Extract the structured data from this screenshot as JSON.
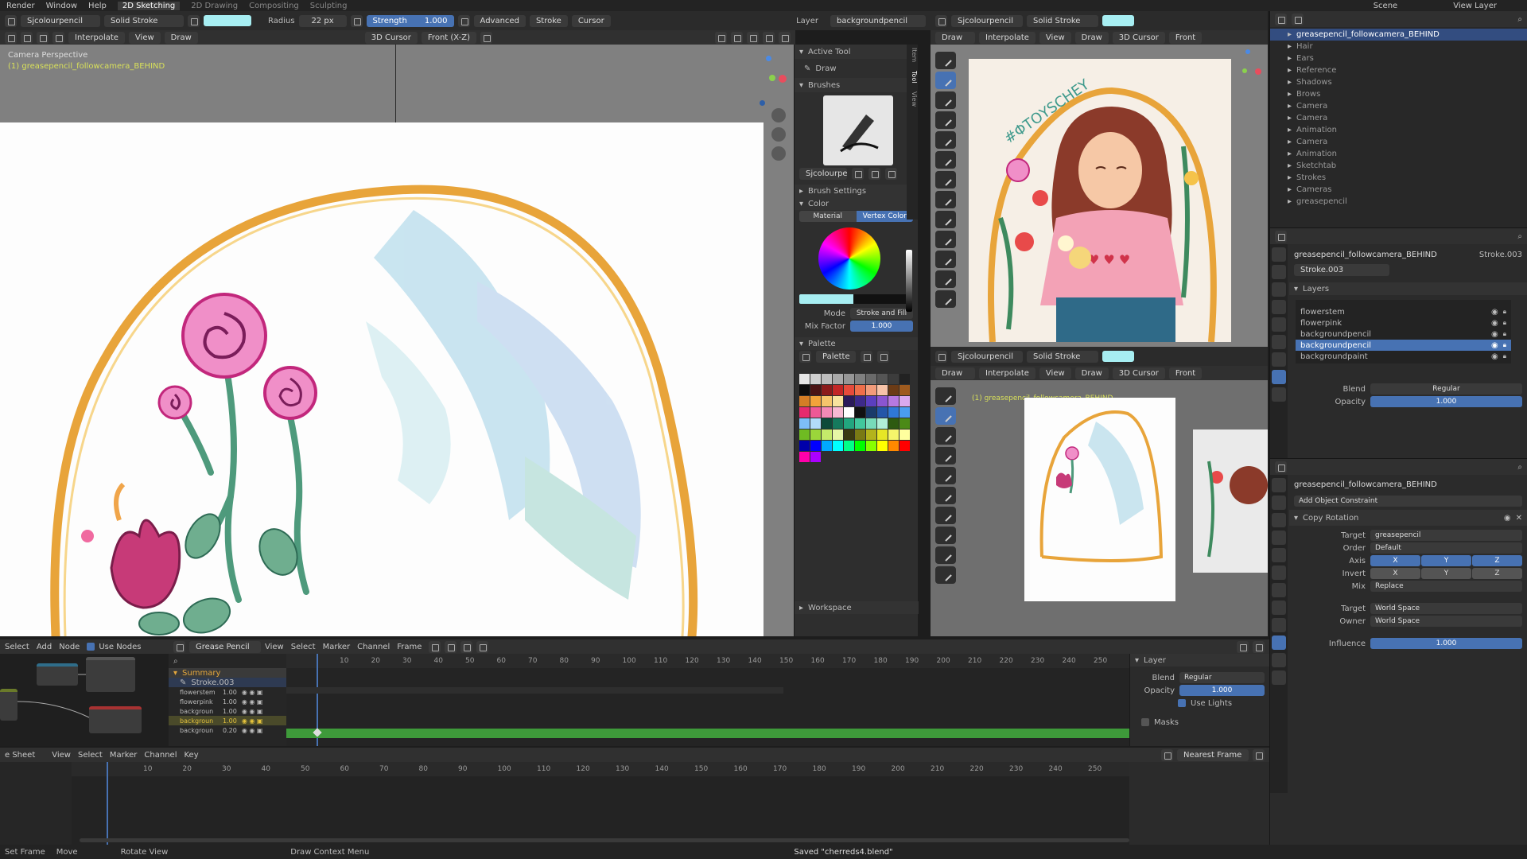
{
  "topbar": {
    "menus": [
      "Render",
      "Window",
      "Help"
    ],
    "workspaces": [
      "2D Sketching",
      "2D Drawing",
      "Compositing",
      "Sculpting"
    ],
    "scene": "Scene",
    "view_layer": "View Layer"
  },
  "toolheader": {
    "object": "Sjcolourpencil",
    "stroke_mode": "Solid Stroke",
    "radius_label": "Radius",
    "radius_value": "22 px",
    "strength_label": "Strength",
    "strength_value": "1.000",
    "advanced": "Advanced",
    "stroke": "Stroke",
    "cursor": "Cursor",
    "layer_label": "Layer",
    "layer_value": "backgroundpencil"
  },
  "mainview": {
    "interpolate": "Interpolate",
    "view": "View",
    "draw": "Draw",
    "cursor3d": "3D Cursor",
    "front": "Front (X-Z)",
    "info": "Camera Perspective",
    "subinfo": "(1) greasepencil_followcamera_BEHIND"
  },
  "sidebar": {
    "tabs": [
      "Item",
      "Tool",
      "View"
    ],
    "active_tool_header": "Active Tool",
    "active_tool": "Draw",
    "brushes_header": "Brushes",
    "brush_name": "Sjcolourpe...",
    "brush_settings": "Brush Settings",
    "color_header": "Color",
    "color_tabs": [
      "Material",
      "Vertex Color"
    ],
    "mode_label": "Mode",
    "mode_value": "Stroke and Fill",
    "mix_label": "Mix Factor",
    "mix_value": "1.000",
    "palette_header": "Palette",
    "palette_name": "Palette",
    "workspace": "Workspace"
  },
  "palette": {
    "colors": [
      "#e6e6e6",
      "#cfcfcf",
      "#bdbdbd",
      "#a9a9a9",
      "#969696",
      "#808080",
      "#6a6a6a",
      "#555555",
      "#3c3c3c",
      "#222222",
      "#0d0d0d",
      "#4b1414",
      "#8b1b1b",
      "#c22626",
      "#e64a3b",
      "#ef6e4a",
      "#f29b7a",
      "#f7c3a8",
      "#6b3b16",
      "#9e5a1e",
      "#d47d25",
      "#f2a33a",
      "#f5c56b",
      "#f7e39e",
      "#2b1a5a",
      "#3d2a8a",
      "#5b3fbf",
      "#8a55d1",
      "#b679e0",
      "#d9a9ee",
      "#e62a6e",
      "#ef5896",
      "#f48ab6",
      "#f7b9d3",
      "#ffffff",
      "#111111",
      "#1a3a6a",
      "#2456a8",
      "#2f78d6",
      "#4a9df0",
      "#7dbef7",
      "#b3dcfa",
      "#0d4a3a",
      "#157a5d",
      "#22a67f",
      "#41c79c",
      "#77dbb9",
      "#b0eed6",
      "#2e5a10",
      "#4b8a17",
      "#6fbb22",
      "#9bd63a",
      "#c4ea6a",
      "#e6f7a6",
      "#3a3a10",
      "#7a7a14",
      "#b3b31c",
      "#e6e626",
      "#f5f56b",
      "#ffff9e",
      "#0000aa",
      "#0000ff",
      "#00aaff",
      "#00ffff",
      "#00ff88",
      "#00ff00",
      "#88ff00",
      "#ffff00",
      "#ff8800",
      "#ff0000",
      "#ff00aa",
      "#aa00ff"
    ]
  },
  "rightview": {
    "object": "Sjcolourpencil",
    "stroke_mode": "Solid Stroke",
    "mode": "Draw",
    "interpolate": "Interpolate",
    "view": "View",
    "draw": "Draw",
    "cursor3d": "3D Cursor",
    "front": "Front",
    "info": "(1) greasepencil_followcamera_BEHIND",
    "illustration_text": "#ΦΤΟΥSCHEY"
  },
  "outliner": {
    "items": [
      {
        "label": "greasepencil_followcamera_BEHIND",
        "sel": true
      },
      {
        "label": "Hair",
        "sel": false
      },
      {
        "label": "Ears",
        "sel": false
      },
      {
        "label": "Reference",
        "sel": false
      },
      {
        "label": "Shadows",
        "sel": false
      },
      {
        "label": "Brows",
        "sel": false
      },
      {
        "label": "Camera",
        "sel": false
      },
      {
        "label": "Camera",
        "sel": false
      },
      {
        "label": "Animation",
        "sel": false
      },
      {
        "label": "Camera",
        "sel": false
      },
      {
        "label": "Animation",
        "sel": false
      },
      {
        "label": "Sketchtab",
        "sel": false
      },
      {
        "label": "Strokes",
        "sel": false
      },
      {
        "label": "Cameras",
        "sel": false
      },
      {
        "label": "greasepencil",
        "sel": false
      }
    ]
  },
  "properties": {
    "object": "greasepencil_followcamera_BEHIND",
    "data": "Stroke.003",
    "data_name": "Stroke.003",
    "layers_header": "Layers",
    "layers": [
      "flowerstem",
      "flowerpink",
      "backgroundpencil",
      "backgroundpencil",
      "backgroundpaint"
    ],
    "active_layer": "backgroundpencil",
    "blend_label": "Blend",
    "blend_value": "Regular",
    "opacity_label": "Opacity",
    "opacity_value": "1.000"
  },
  "constraints": {
    "object": "greasepencil_followcamera_BEHIND",
    "add": "Add Object Constraint",
    "name": "Copy Rotation",
    "target_label": "Target",
    "target_value": "greasepencil",
    "order_label": "Order",
    "order_value": "Default",
    "axis_label": "Axis",
    "axis": [
      "X",
      "Y",
      "Z"
    ],
    "invert_label": "Invert",
    "invert": [
      "X",
      "Y",
      "Z"
    ],
    "mix_label": "Mix",
    "mix_value": "Replace",
    "target_space_label": "Target",
    "target_space": "World Space",
    "owner_label": "Owner",
    "owner_space": "World Space",
    "influence_label": "Influence",
    "influence_value": "1.000"
  },
  "dopesheet": {
    "menus": [
      "Select",
      "Add",
      "Node",
      "Use Nodes"
    ],
    "mode": "Grease Pencil",
    "view": "View",
    "select": "Select",
    "marker": "Marker",
    "channel": "Channel",
    "frame": "Frame",
    "summary": "Summary",
    "group": "Stroke.003",
    "channels": [
      {
        "name": "flowerstem",
        "val": "1.00"
      },
      {
        "name": "flowerpink",
        "val": "1.00"
      },
      {
        "name": "backgroun",
        "val": "1.00"
      },
      {
        "name": "backgroun",
        "val": "1.00"
      },
      {
        "name": "backgroun",
        "val": "0.20"
      }
    ],
    "ruler": [
      "10",
      "20",
      "30",
      "40",
      "50",
      "60",
      "70",
      "80",
      "90",
      "100",
      "110",
      "120",
      "130",
      "140",
      "150",
      "160",
      "170",
      "180",
      "190",
      "200",
      "210",
      "220",
      "230",
      "240",
      "250"
    ],
    "layer_header": "Layer",
    "blend_label": "Blend",
    "blend_value": "Regular",
    "opacity_label": "Opacity",
    "opacity_value": "1.000",
    "use_lights": "Use Lights",
    "masks": "Masks"
  },
  "timeline": {
    "menus": [
      "e Sheet",
      "View",
      "Select",
      "Marker",
      "Channel",
      "Key"
    ],
    "snap": "Nearest Frame",
    "ruler": [
      "10",
      "20",
      "30",
      "40",
      "50",
      "60",
      "70",
      "80",
      "90",
      "100",
      "110",
      "120",
      "130",
      "140",
      "150",
      "160",
      "170",
      "180",
      "190",
      "200",
      "210",
      "220",
      "230",
      "240",
      "250"
    ]
  },
  "statusbar": {
    "items": [
      "Set Frame",
      "Move",
      "Rotate View",
      "Draw Context Menu"
    ],
    "saved": "Saved \"cherreds4.blend\""
  }
}
